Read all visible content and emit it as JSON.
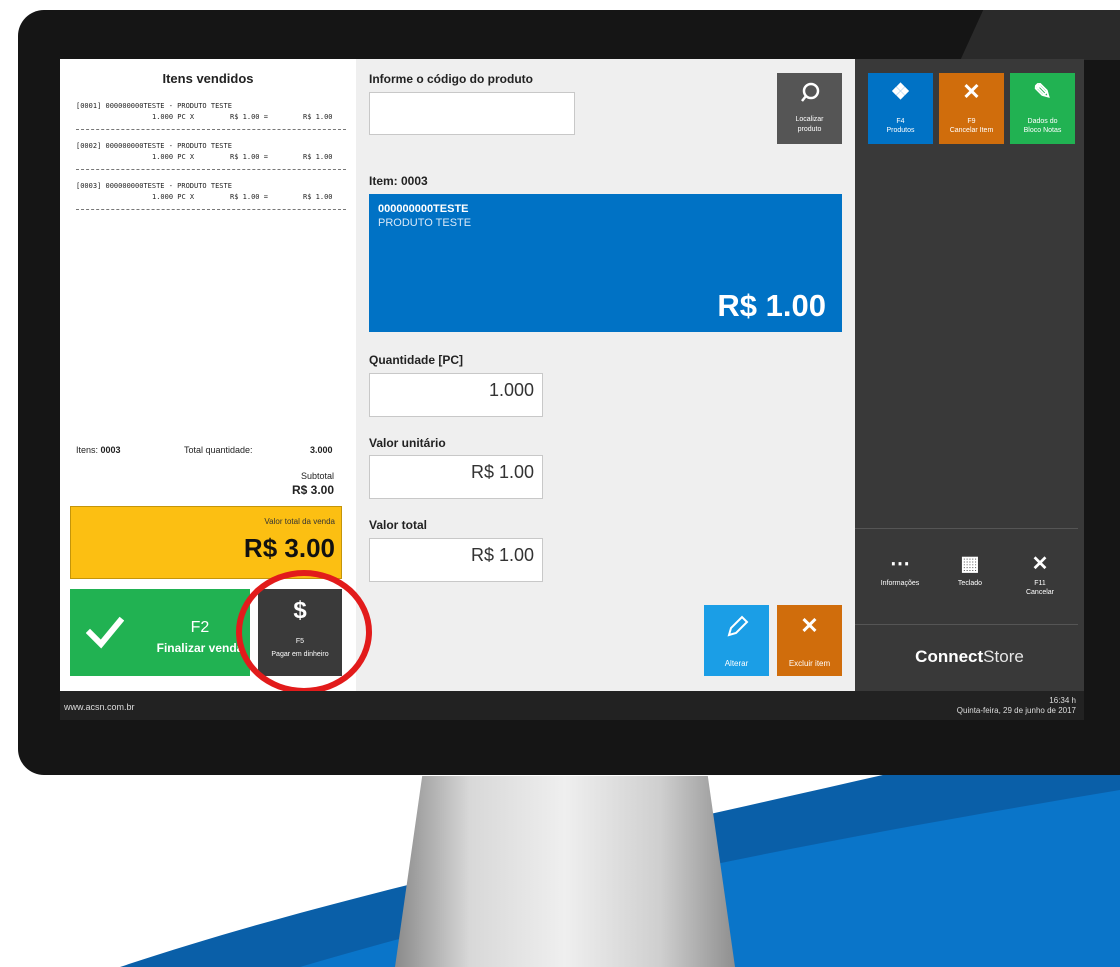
{
  "receipt": {
    "title": "Itens vendidos",
    "lines": [
      {
        "head": "[0001] 000000000TESTE - PRODUTO TESTE",
        "qty": "1.000 PC X",
        "unit": "R$ 1.00 =",
        "total": "R$ 1.00"
      },
      {
        "head": "[0002] 000000000TESTE - PRODUTO TESTE",
        "qty": "1.000 PC X",
        "unit": "R$ 1.00 =",
        "total": "R$ 1.00"
      },
      {
        "head": "[0003] 000000000TESTE - PRODUTO TESTE",
        "qty": "1.000 PC X",
        "unit": "R$ 1.00 =",
        "total": "R$ 1.00"
      }
    ],
    "items_label": "Itens:",
    "items_value": "0003",
    "total_qty_label": "Total quantidade:",
    "total_qty_value": "3.000",
    "subtotal_label": "Subtotal",
    "subtotal_value": "R$ 3.00",
    "sale_total_label": "Valor total da venda",
    "sale_total_value": "R$ 3.00"
  },
  "finalize": {
    "key": "F2",
    "label": "Finalizar venda"
  },
  "cash": {
    "icon": "$",
    "key": "F5",
    "label": "Pagar em dinheiro"
  },
  "product_search": {
    "label": "Informe o código do produto",
    "value": "",
    "button_line1": "Localizar",
    "button_line2": "produto"
  },
  "item": {
    "label": "Item: 0003",
    "code": "000000000TESTE",
    "name": "PRODUTO TESTE",
    "price": "R$ 1.00"
  },
  "quantity": {
    "label": "Quantidade [PC]",
    "value": "1.000"
  },
  "unit_value": {
    "label": "Valor unitário",
    "value": "R$ 1.00"
  },
  "total_value": {
    "label": "Valor total",
    "value": "R$ 1.00"
  },
  "actions": {
    "edit_label": "Alterar",
    "delete_label": "Excluir item"
  },
  "right_panel": {
    "tiles": [
      {
        "key": "F4",
        "label": "Produtos",
        "color": "#0072c5"
      },
      {
        "key": "F9",
        "label": "Cancelar Item",
        "color": "#d06d0c"
      },
      {
        "key": "Dados do",
        "label": "Bloco Notas",
        "color": "#21b252"
      }
    ],
    "tools": [
      {
        "key": "",
        "label": "Informações"
      },
      {
        "key": "",
        "label": "Teclado"
      },
      {
        "key": "F11",
        "label": "Cancelar"
      }
    ],
    "brand_bold": "Connect",
    "brand_light": "Store"
  },
  "footer": {
    "url": "www.acsn.com.br",
    "time": "16:34 h",
    "date": "Quinta-feira, 29  de  junho  de  2017"
  },
  "colors": {
    "blue": "#0072c5",
    "orange": "#d06d0c",
    "green": "#21b252",
    "yellow": "#fcbf12",
    "dark": "#393939",
    "highlight_circle": "#e21b1b"
  }
}
